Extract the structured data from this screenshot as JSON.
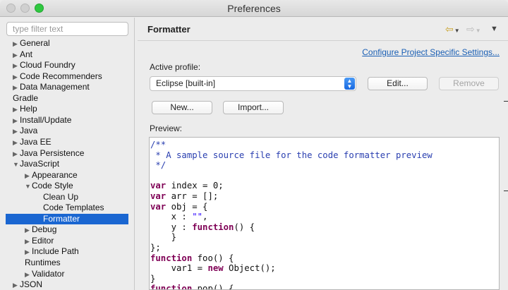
{
  "window": {
    "title": "Preferences"
  },
  "filter": {
    "placeholder": "type filter text"
  },
  "tree": [
    {
      "label": "General",
      "arrow": "▶",
      "level": 0
    },
    {
      "label": "Ant",
      "arrow": "▶",
      "level": 0
    },
    {
      "label": "Cloud Foundry",
      "arrow": "▶",
      "level": 0
    },
    {
      "label": "Code Recommenders",
      "arrow": "▶",
      "level": 0
    },
    {
      "label": "Data Management",
      "arrow": "▶",
      "level": 0
    },
    {
      "label": "Gradle",
      "arrow": "",
      "level": 0
    },
    {
      "label": "Help",
      "arrow": "▶",
      "level": 0
    },
    {
      "label": "Install/Update",
      "arrow": "▶",
      "level": 0
    },
    {
      "label": "Java",
      "arrow": "▶",
      "level": 0
    },
    {
      "label": "Java EE",
      "arrow": "▶",
      "level": 0
    },
    {
      "label": "Java Persistence",
      "arrow": "▶",
      "level": 0
    },
    {
      "label": "JavaScript",
      "arrow": "▼",
      "level": 0
    },
    {
      "label": "Appearance",
      "arrow": "▶",
      "level": 1
    },
    {
      "label": "Code Style",
      "arrow": "▼",
      "level": 1
    },
    {
      "label": "Clean Up",
      "arrow": "",
      "level": 2
    },
    {
      "label": "Code Templates",
      "arrow": "",
      "level": 2
    },
    {
      "label": "Formatter",
      "arrow": "",
      "level": 2,
      "selected": true
    },
    {
      "label": "Debug",
      "arrow": "▶",
      "level": 1
    },
    {
      "label": "Editor",
      "arrow": "▶",
      "level": 1
    },
    {
      "label": "Include Path",
      "arrow": "▶",
      "level": 1
    },
    {
      "label": "Runtimes",
      "arrow": "",
      "level": 1
    },
    {
      "label": "Validator",
      "arrow": "▶",
      "level": 1
    },
    {
      "label": "JSON",
      "arrow": "▶",
      "level": 0
    }
  ],
  "page": {
    "title": "Formatter",
    "configure_link": "Configure Project Specific Settings...",
    "active_profile_label": "Active profile:",
    "profile_value": "Eclipse [built-in]",
    "edit_label": "Edit...",
    "remove_label": "Remove",
    "new_label": "New...",
    "import_label": "Import...",
    "preview_label": "Preview:"
  },
  "nav": {
    "back_icon": "back-arrow-icon",
    "forward_icon": "forward-arrow-icon",
    "menu_icon": "view-menu-icon"
  },
  "code_lines": [
    [
      {
        "t": "/**",
        "c": "cm"
      }
    ],
    [
      {
        "t": " * A sample source file for the code formatter preview",
        "c": "cm"
      }
    ],
    [
      {
        "t": " */",
        "c": "cm"
      }
    ],
    [
      {
        "t": "",
        "c": ""
      }
    ],
    [
      {
        "t": "var",
        "c": "kw"
      },
      {
        "t": " index = 0;",
        "c": ""
      }
    ],
    [
      {
        "t": "var",
        "c": "kw"
      },
      {
        "t": " arr = [];",
        "c": ""
      }
    ],
    [
      {
        "t": "var",
        "c": "kw"
      },
      {
        "t": " obj = {",
        "c": ""
      }
    ],
    [
      {
        "t": "    x : ",
        "c": ""
      },
      {
        "t": "\"\"",
        "c": "str"
      },
      {
        "t": ",",
        "c": ""
      }
    ],
    [
      {
        "t": "    y : ",
        "c": ""
      },
      {
        "t": "function",
        "c": "kw"
      },
      {
        "t": "() {",
        "c": ""
      }
    ],
    [
      {
        "t": "    }",
        "c": ""
      }
    ],
    [
      {
        "t": "};",
        "c": ""
      }
    ],
    [
      {
        "t": "function",
        "c": "kw"
      },
      {
        "t": " foo() {",
        "c": ""
      }
    ],
    [
      {
        "t": "    var1 = ",
        "c": ""
      },
      {
        "t": "new",
        "c": "kw"
      },
      {
        "t": " Object();",
        "c": ""
      }
    ],
    [
      {
        "t": "}",
        "c": ""
      }
    ],
    [
      {
        "t": "function",
        "c": "kw"
      },
      {
        "t": " pop() {",
        "c": ""
      }
    ]
  ]
}
